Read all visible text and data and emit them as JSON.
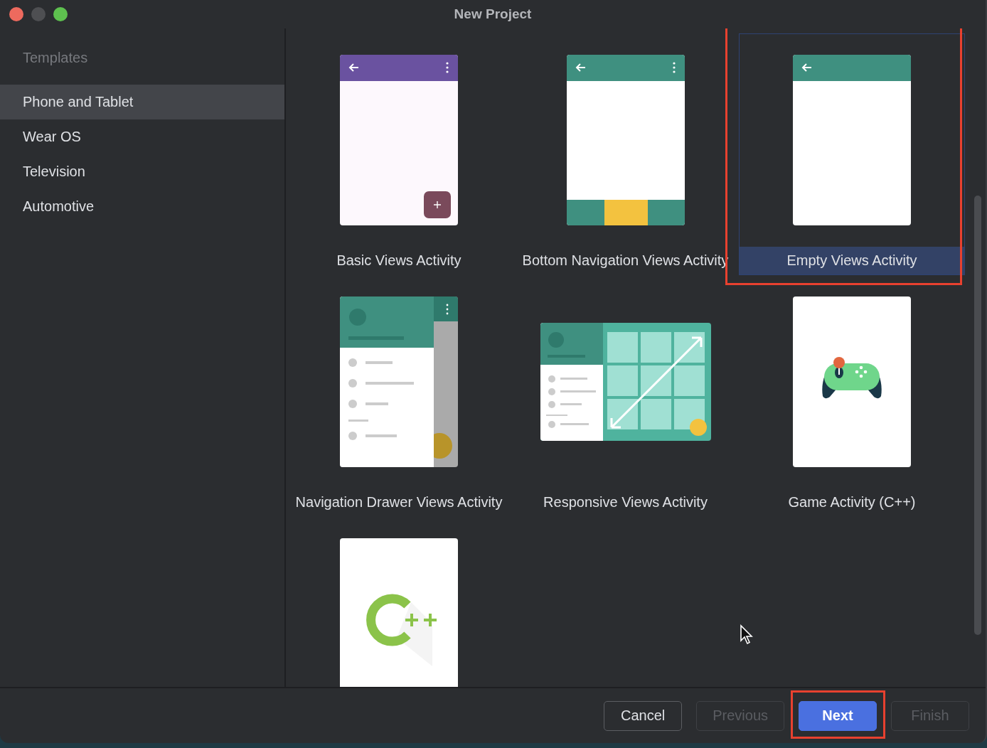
{
  "window": {
    "title": "New Project"
  },
  "sidebar": {
    "heading": "Templates",
    "items": [
      {
        "label": "Phone and Tablet",
        "selected": true
      },
      {
        "label": "Wear OS",
        "selected": false
      },
      {
        "label": "Television",
        "selected": false
      },
      {
        "label": "Automotive",
        "selected": false
      }
    ]
  },
  "templates": [
    {
      "kind": "basic",
      "label": "Basic Views Activity",
      "selected": false,
      "highlighted": false
    },
    {
      "kind": "bottom-nav",
      "label": "Bottom Navigation Views Activity",
      "selected": false,
      "highlighted": false
    },
    {
      "kind": "empty",
      "label": "Empty Views Activity",
      "selected": true,
      "highlighted": true
    },
    {
      "kind": "nav-drawer",
      "label": "Navigation Drawer Views Activity",
      "selected": false,
      "highlighted": false
    },
    {
      "kind": "responsive",
      "label": "Responsive Views Activity",
      "selected": false,
      "highlighted": false
    },
    {
      "kind": "game",
      "label": "Game Activity (C++)",
      "selected": false,
      "highlighted": false
    },
    {
      "kind": "cpp",
      "selected": false,
      "highlighted": false
    }
  ],
  "buttons": [
    {
      "kind": "secondary",
      "label": "Cancel",
      "disabled": false,
      "highlighted": false
    },
    {
      "kind": "secondary",
      "label": "Previous",
      "disabled": true,
      "highlighted": false
    },
    {
      "kind": "primary",
      "label": "Next",
      "disabled": false,
      "highlighted": true
    },
    {
      "kind": "secondary",
      "label": "Finish",
      "disabled": true,
      "highlighted": false
    }
  ]
}
